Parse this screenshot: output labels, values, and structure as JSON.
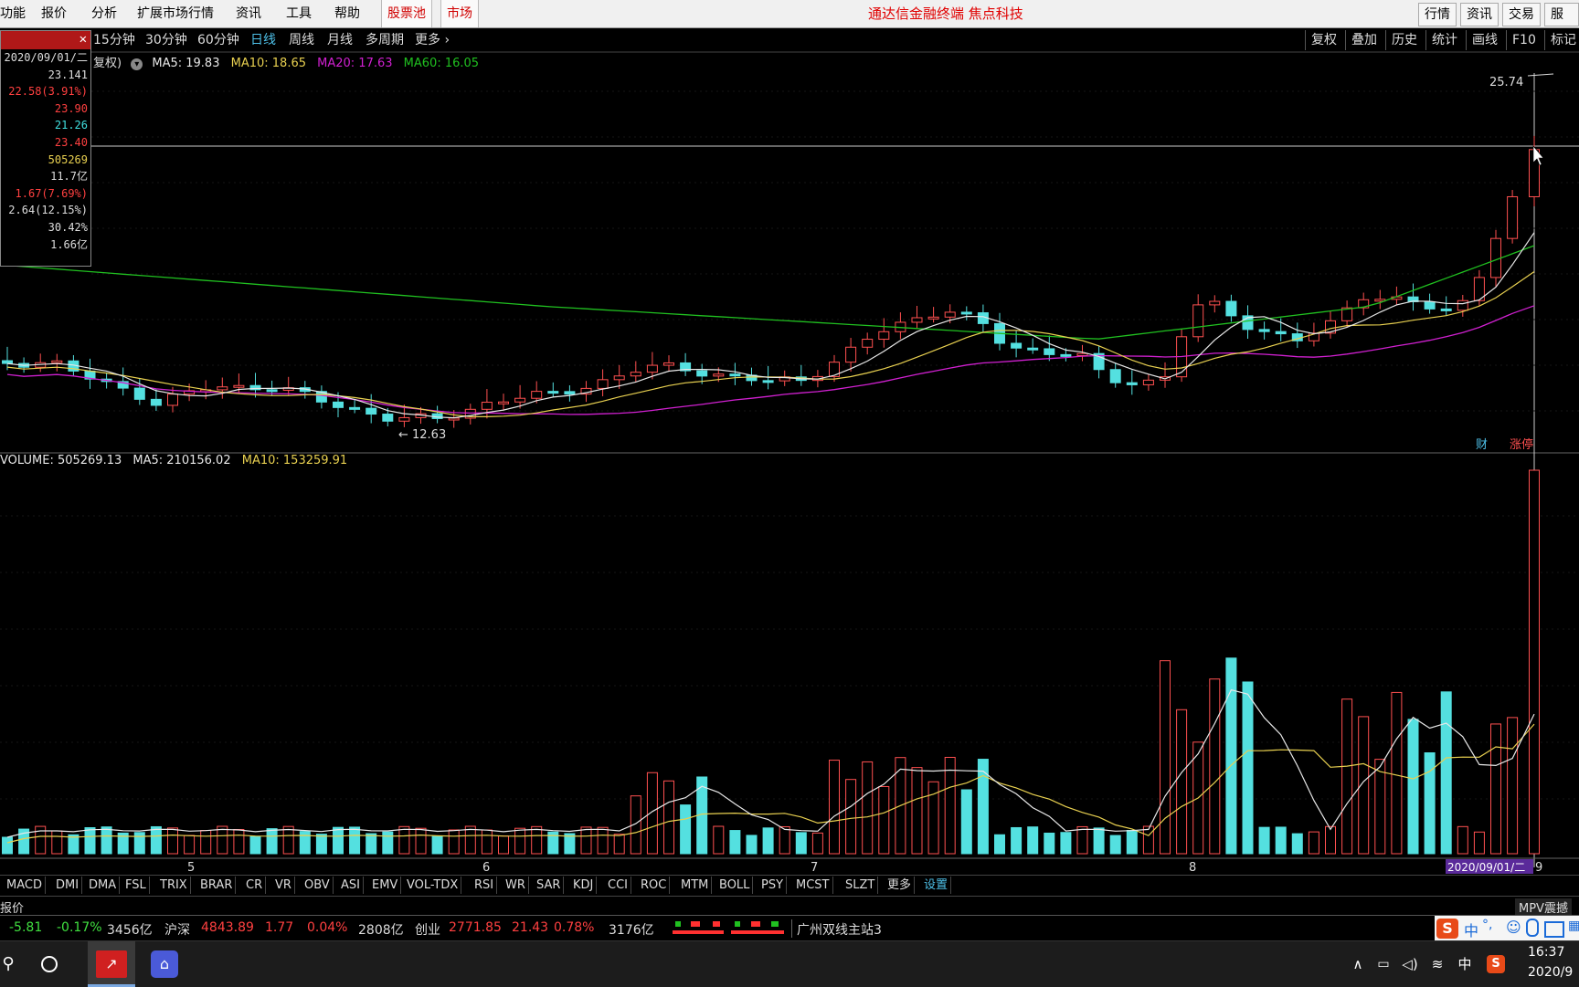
{
  "menubar": {
    "items": [
      "功能",
      "报价",
      "分析",
      "扩展市场行情",
      "资讯",
      "工具",
      "帮助"
    ],
    "red_items": [
      "股票池",
      "市场"
    ],
    "title": "通达信金融终端  焦点科技",
    "right_buttons": [
      "行情",
      "资讯",
      "交易",
      "服务"
    ]
  },
  "periodbar": {
    "items": [
      "15分钟",
      "30分钟",
      "60分钟",
      "日线",
      "周线",
      "月线",
      "多周期",
      "更多"
    ],
    "active": "日线",
    "right_tools": [
      "复权",
      "叠加",
      "历史",
      "统计",
      "画线",
      "F10",
      "标记"
    ]
  },
  "ma_legend": {
    "prefix": "复权)",
    "items": [
      {
        "label": "MA5: 19.83",
        "color": "#e8e8e8"
      },
      {
        "label": "MA10: 18.65",
        "color": "#e8d050"
      },
      {
        "label": "MA20: 17.63",
        "color": "#d020d0"
      },
      {
        "label": "MA60: 16.05",
        "color": "#20c020"
      }
    ]
  },
  "infobox": {
    "date": "2020/09/01/二",
    "rows": [
      {
        "text": "23.141",
        "color": "#dddddd"
      },
      {
        "text": "22.58(3.91%)",
        "color": "#ff4040"
      },
      {
        "text": "23.90",
        "color": "#ff4040"
      },
      {
        "text": "21.26",
        "color": "#40e0e0"
      },
      {
        "text": "23.40",
        "color": "#ff4040"
      },
      {
        "text": "505269",
        "color": "#e8d050"
      },
      {
        "text": "11.7亿",
        "color": "#dddddd"
      },
      {
        "text": "1.67(7.69%)",
        "color": "#ff4040"
      },
      {
        "text": "2.64(12.15%)",
        "color": "#dddddd"
      },
      {
        "text": "30.42%",
        "color": "#dddddd"
      },
      {
        "text": "1.66亿",
        "color": "#dddddd"
      }
    ]
  },
  "price_chart": {
    "high_label": "25.74",
    "low_label": "12.63",
    "cai_badge": "财",
    "zhangting_badge": "涨停",
    "colors": {
      "up": "#ff5050",
      "down": "#54e0e0",
      "ma5": "#e8e8e8",
      "ma10": "#e8d050",
      "ma20": "#d020d0",
      "ma60": "#20c020"
    }
  },
  "volume_legend": {
    "items": [
      {
        "label": "VOLUME: 505269.13",
        "color": "#e8e8e8"
      },
      {
        "label": "MA5: 210156.02",
        "color": "#e8e8e8"
      },
      {
        "label": "MA10: 153259.91",
        "color": "#e8d050"
      }
    ]
  },
  "x_axis": {
    "month_labels": [
      "5",
      "6",
      "7",
      "8",
      "9"
    ],
    "cursor_date": "2020/09/01/二"
  },
  "indicator_bar": {
    "items": [
      "MACD",
      "DMI",
      "DMA",
      "FSL",
      "TRIX",
      "BRAR",
      "CR",
      "VR",
      "OBV",
      "ASI",
      "EMV",
      "VOL-TDX",
      "RSI",
      "WR",
      "SAR",
      "KDJ",
      "CCI",
      "ROC",
      "MTM",
      "BOLL",
      "PSY",
      "MCST",
      "SLZT",
      "更多",
      "设置"
    ],
    "active": "设置"
  },
  "quote_strip": {
    "left_label": "报价",
    "right_label": "MPV震撼"
  },
  "statusbar": {
    "sh_change": "-5.81",
    "sh_pct": "-0.17%",
    "sh_amount": "3456亿",
    "sz_name": "沪深",
    "sz_value": "4843.89",
    "sz_change": "1.77",
    "sz_pct": "0.04%",
    "sz_amount": "2808亿",
    "cy_name": "创业",
    "cy_value": "2771.85",
    "cy_change": "21.43",
    "cy_pct": "0.78%",
    "cy_amount": "3176亿",
    "station": "广州双线主站3"
  },
  "taskbar": {
    "time": "16:37",
    "date": "2020/9",
    "ime_label": "中",
    "tray_lang": "中"
  }
}
